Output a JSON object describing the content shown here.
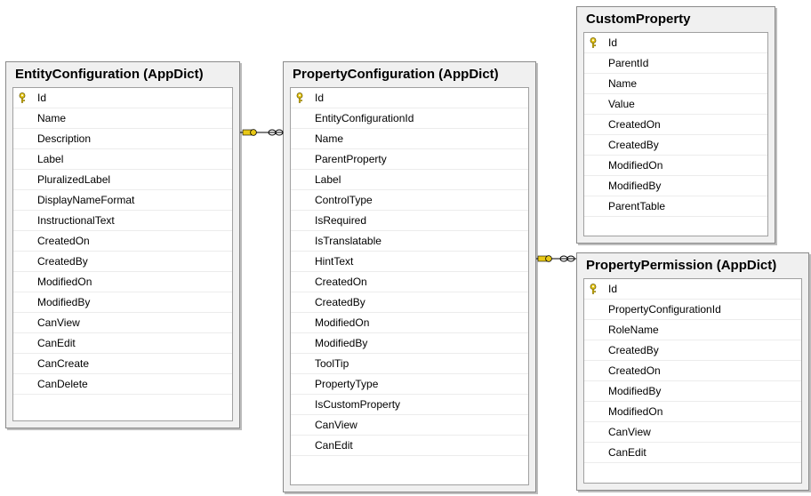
{
  "tables": [
    {
      "id": "entity-configuration",
      "title": "EntityConfiguration (AppDict)",
      "columns": [
        "Id",
        "Name",
        "Description",
        "Label",
        "PluralizedLabel",
        "DisplayNameFormat",
        "InstructionalText",
        "CreatedOn",
        "CreatedBy",
        "ModifiedOn",
        "ModifiedBy",
        "CanView",
        "CanEdit",
        "CanCreate",
        "CanDelete"
      ],
      "primary_key": "Id"
    },
    {
      "id": "property-configuration",
      "title": "PropertyConfiguration (AppDict)",
      "columns": [
        "Id",
        "EntityConfigurationId",
        "Name",
        "ParentProperty",
        "Label",
        "ControlType",
        "IsRequired",
        "IsTranslatable",
        "HintText",
        "CreatedOn",
        "CreatedBy",
        "ModifiedOn",
        "ModifiedBy",
        "ToolTip",
        "PropertyType",
        "IsCustomProperty",
        "CanView",
        "CanEdit"
      ],
      "primary_key": "Id"
    },
    {
      "id": "custom-property",
      "title": "CustomProperty",
      "columns": [
        "Id",
        "ParentId",
        "Name",
        "Value",
        "CreatedOn",
        "CreatedBy",
        "ModifiedOn",
        "ModifiedBy",
        "ParentTable"
      ],
      "primary_key": "Id"
    },
    {
      "id": "property-permission",
      "title": "PropertyPermission (AppDict)",
      "columns": [
        "Id",
        "PropertyConfigurationId",
        "RoleName",
        "CreatedBy",
        "CreatedOn",
        "ModifiedBy",
        "ModifiedOn",
        "CanView",
        "CanEdit"
      ],
      "primary_key": "Id"
    }
  ],
  "relationships": [
    {
      "from": "entity-configuration",
      "to": "property-configuration",
      "one_end": "entity-configuration",
      "many_end": "property-configuration"
    },
    {
      "from": "property-configuration",
      "to": "property-permission",
      "one_end": "property-configuration",
      "many_end": "property-permission"
    }
  ],
  "colors": {
    "key_icon": "#e8c817",
    "border": "#8a8a8a",
    "background": "#f0f0f0"
  },
  "icons": {
    "primary_key": "key-icon"
  }
}
